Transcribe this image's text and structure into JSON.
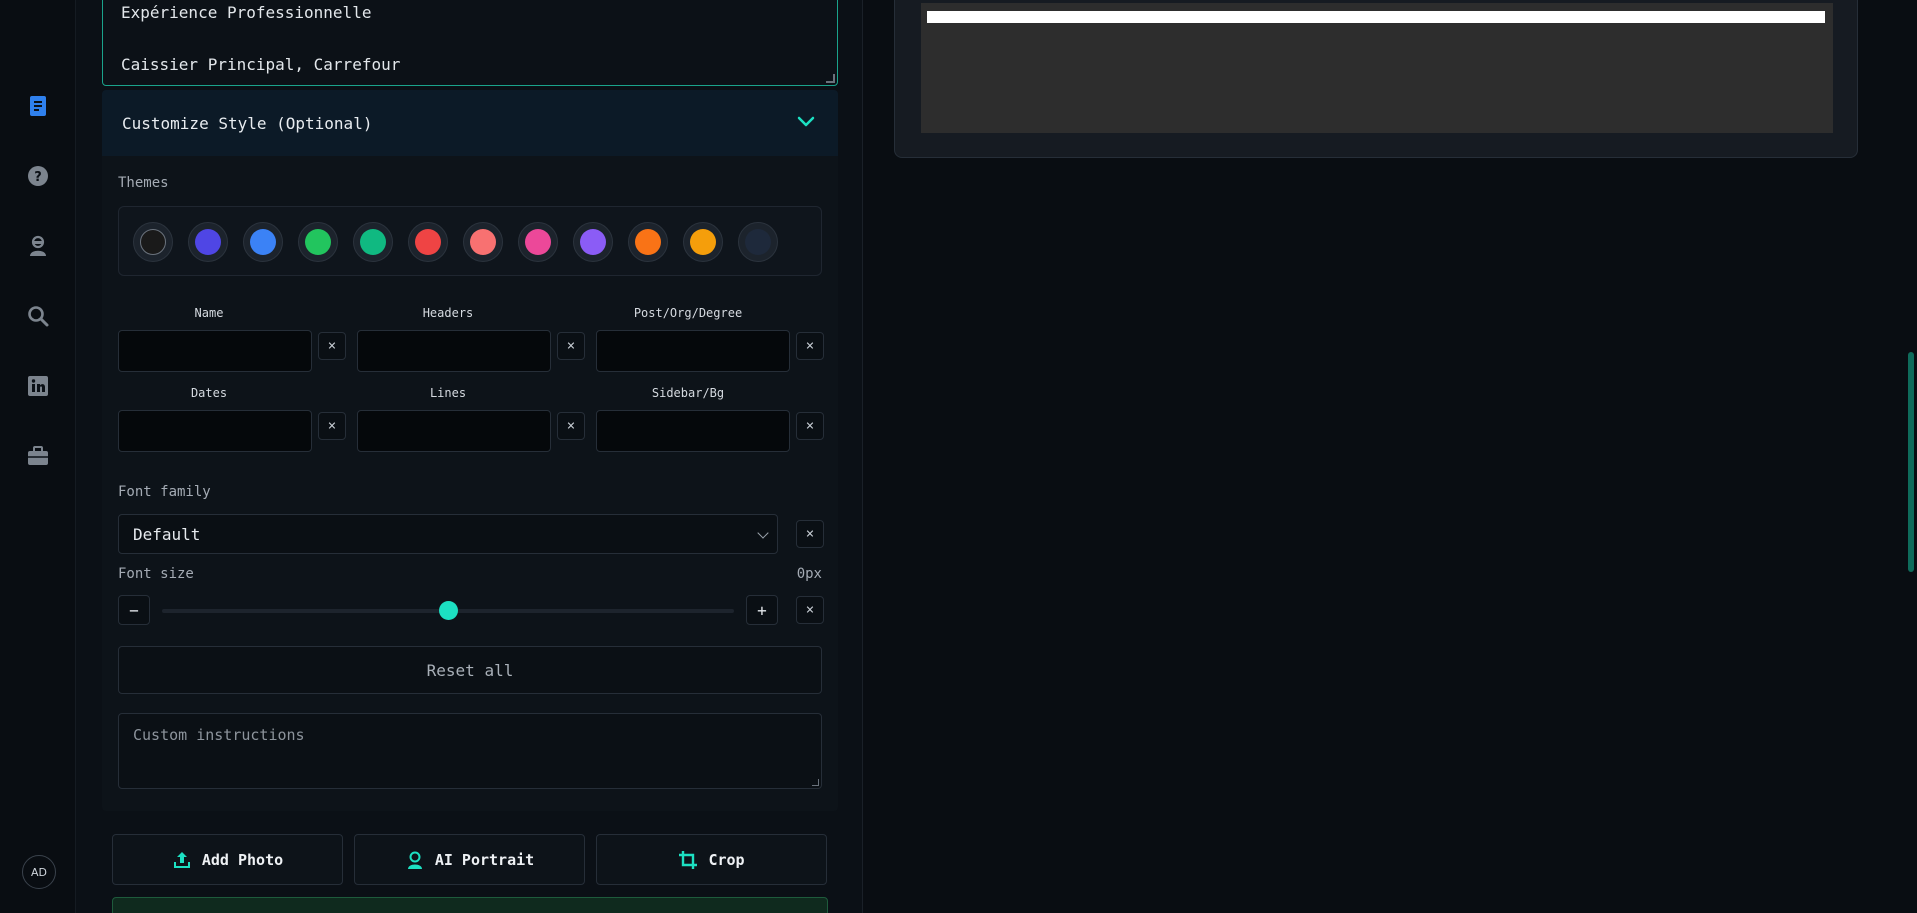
{
  "sidebar": {
    "icons": [
      {
        "name": "resume-icon",
        "active": true
      },
      {
        "name": "help-icon",
        "active": false
      },
      {
        "name": "interview-icon",
        "active": false
      },
      {
        "name": "search-icon",
        "active": false
      },
      {
        "name": "linkedin-icon",
        "active": false
      },
      {
        "name": "briefcase-icon",
        "active": false
      }
    ],
    "avatar_initials": "AD"
  },
  "resume_text": {
    "line1": "Expérience Professionnelle",
    "line2": "Caissier Principal, Carrefour"
  },
  "customize": {
    "title": "Customize Style (Optional)",
    "themes_label": "Themes",
    "themes": [
      "#1a1a1a",
      "#4f46e5",
      "#3b82f6",
      "#22c55e",
      "#10b981",
      "#ef4444",
      "#f87171",
      "#ec4899",
      "#8b5cf6",
      "#f97316",
      "#f59e0b",
      "#1e293b"
    ],
    "fields": {
      "name": "Name",
      "headers": "Headers",
      "post": "Post/Org/Degree",
      "dates": "Dates",
      "lines": "Lines",
      "sidebar": "Sidebar/Bg"
    },
    "clear_symbol": "×",
    "font_family_label": "Font family",
    "font_family_value": "Default",
    "font_size_label": "Font size",
    "font_size_value": "0px",
    "font_size_level": 0.5,
    "minus": "−",
    "plus": "+",
    "reset_label": "Reset all",
    "instructions_placeholder": "Custom instructions"
  },
  "actions": {
    "add_photo": "Add Photo",
    "ai_portrait": "AI Portrait",
    "crop": "Crop"
  },
  "colors": {
    "accent": "#1ce0c2",
    "active_icon": "#2f80ed"
  }
}
